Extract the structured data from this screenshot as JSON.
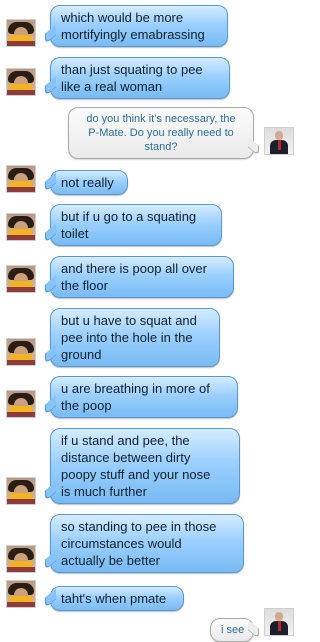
{
  "conversation": {
    "messages": [
      {
        "from": "them",
        "lines": [
          "which would be more",
          "mortifyingly emabrassing"
        ]
      },
      {
        "from": "them",
        "lines": [
          "than just squating to pee",
          "like a real woman"
        ]
      },
      {
        "from": "me",
        "lines": [
          "do you think it's necessary, the",
          "P-Mate. Do you really need to",
          "stand?"
        ]
      },
      {
        "from": "them",
        "lines": [
          "not really"
        ]
      },
      {
        "from": "them",
        "lines": [
          "but if u go to a squating",
          "toilet"
        ]
      },
      {
        "from": "them",
        "lines": [
          "and there is poop all over",
          "the floor"
        ]
      },
      {
        "from": "them",
        "lines": [
          "but u have to squat and",
          "pee into the hole in the",
          "ground"
        ]
      },
      {
        "from": "them",
        "lines": [
          "u are breathing in more of",
          "the poop"
        ]
      },
      {
        "from": "them",
        "lines": [
          "if u stand and pee, the",
          "distance between dirty",
          "poopy stuff and your nose",
          "is much further"
        ]
      },
      {
        "from": "them",
        "lines": [
          "so standing to pee in those",
          "circumstances would",
          "actually be better"
        ]
      },
      {
        "from": "them",
        "lines": [
          "taht's when pmate"
        ]
      },
      {
        "from": "me",
        "lines": [
          "i see"
        ]
      }
    ]
  },
  "colors": {
    "their_bubble": "#9cd0ff",
    "their_border": "#5c97cf",
    "my_bubble": "#eaeaea",
    "my_text": "#2e6f94"
  },
  "icons": {
    "their_avatar": "girl-eating-corn-avatar",
    "my_avatar": "man-in-suit-avatar"
  }
}
